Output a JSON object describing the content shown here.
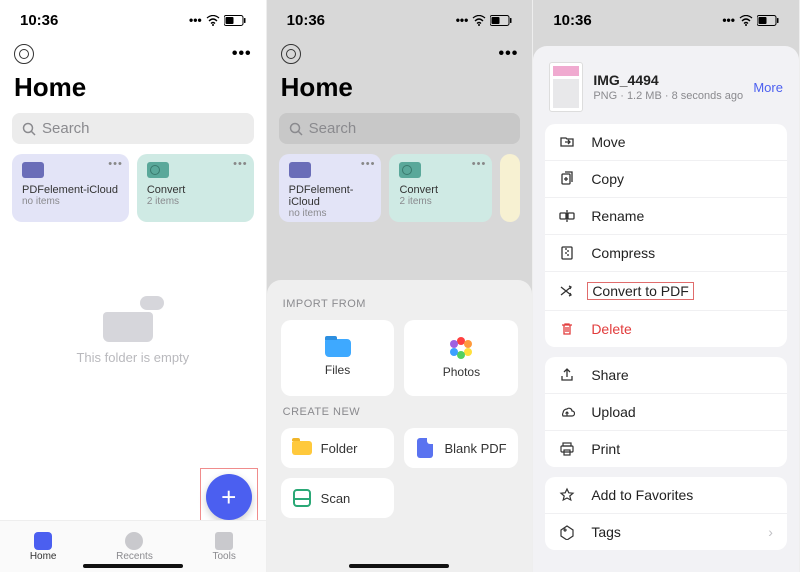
{
  "status": {
    "time": "10:36",
    "wifi": "wifi",
    "battery": "battery"
  },
  "screen1": {
    "title": "Home",
    "search_placeholder": "Search",
    "cards": [
      {
        "name": "PDFelement-iCloud",
        "sub": "no items"
      },
      {
        "name": "Convert",
        "sub": "2 items"
      }
    ],
    "empty": "This folder is empty",
    "tabs": [
      {
        "label": "Home",
        "active": true
      },
      {
        "label": "Recents",
        "active": false
      },
      {
        "label": "Tools",
        "active": false
      }
    ]
  },
  "screen2": {
    "title": "Home",
    "search_placeholder": "Search",
    "cards": [
      {
        "name": "PDFelement-iCloud",
        "sub": "no items"
      },
      {
        "name": "Convert",
        "sub": "2 items"
      }
    ],
    "sheet": {
      "import_label": "IMPORT FROM",
      "import": [
        {
          "label": "Files",
          "icon": "files-icon"
        },
        {
          "label": "Photos",
          "icon": "photos-icon"
        }
      ],
      "create_label": "CREATE NEW",
      "create": [
        {
          "label": "Folder",
          "icon": "folder-icon"
        },
        {
          "label": "Blank PDF",
          "icon": "pdf-icon"
        },
        {
          "label": "Scan",
          "icon": "scan-icon"
        }
      ]
    }
  },
  "screen3": {
    "file": {
      "name": "IMG_4494",
      "type": "PNG",
      "size": "1.2 MB",
      "ago": "8 seconds ago"
    },
    "more": "More",
    "group1": [
      {
        "label": "Move",
        "icon": "move-icon"
      },
      {
        "label": "Copy",
        "icon": "copy-icon"
      },
      {
        "label": "Rename",
        "icon": "rename-icon"
      },
      {
        "label": "Compress",
        "icon": "compress-icon"
      },
      {
        "label": "Convert to PDF",
        "icon": "convert-icon",
        "highlight": true
      },
      {
        "label": "Delete",
        "icon": "trash-icon",
        "danger": true
      }
    ],
    "group2": [
      {
        "label": "Share",
        "icon": "share-icon"
      },
      {
        "label": "Upload",
        "icon": "upload-icon"
      },
      {
        "label": "Print",
        "icon": "print-icon"
      }
    ],
    "group3": [
      {
        "label": "Add to Favorites",
        "icon": "star-icon"
      },
      {
        "label": "Tags",
        "icon": "tag-icon",
        "chevron": true
      }
    ]
  },
  "sep": " · "
}
